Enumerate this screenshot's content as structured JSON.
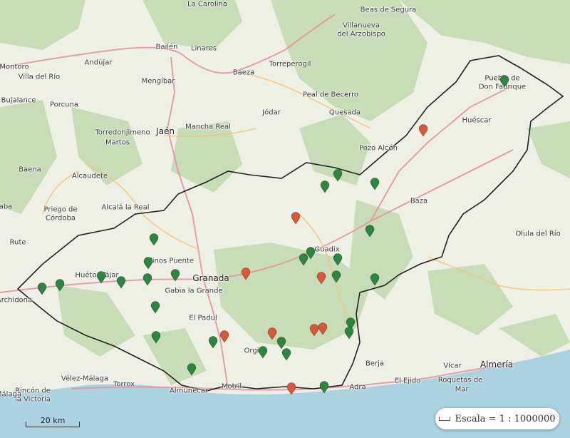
{
  "map": {
    "colors": {
      "route_marker": "#2e8540",
      "site_marker": "#d9573a",
      "province_border": "#222222",
      "sea": "#aad3df",
      "forest": "#c6dcb5"
    },
    "places": [
      {
        "id": "la-carolina",
        "name": "La Carolina"
      },
      {
        "id": "beas-de-segura",
        "name": "Beas de Segura"
      },
      {
        "id": "villanueva",
        "name": "Villanueva"
      },
      {
        "id": "del-arzobispo",
        "name": "del Arzobispo"
      },
      {
        "id": "montoro",
        "name": "Montoro"
      },
      {
        "id": "villa-del-rio",
        "name": "Villa del Río"
      },
      {
        "id": "andujar",
        "name": "Andújar"
      },
      {
        "id": "bailen",
        "name": "Bailén"
      },
      {
        "id": "linares",
        "name": "Linares"
      },
      {
        "id": "baeza",
        "name": "Baeza"
      },
      {
        "id": "torreperogil",
        "name": "Torreperogil"
      },
      {
        "id": "mengibar",
        "name": "Mengíbar"
      },
      {
        "id": "bujalance",
        "name": "Bujalance"
      },
      {
        "id": "porcuna",
        "name": "Porcuna"
      },
      {
        "id": "peal-de-becerro",
        "name": "Peal de Becerro"
      },
      {
        "id": "jodar",
        "name": "Jódar"
      },
      {
        "id": "quesada",
        "name": "Quesada"
      },
      {
        "id": "puebla-de",
        "name": "Puebla de"
      },
      {
        "id": "don-fadrique",
        "name": "Don Fadrique"
      },
      {
        "id": "torredonjimeno",
        "name": "Torredonjimeno"
      },
      {
        "id": "martos",
        "name": "Martos"
      },
      {
        "id": "jaen",
        "name": "Jaén"
      },
      {
        "id": "mancha-real",
        "name": "Mancha Real"
      },
      {
        "id": "huescar",
        "name": "Huéscar"
      },
      {
        "id": "pozo-alcon",
        "name": "Pozo Alcón"
      },
      {
        "id": "baena",
        "name": "Baena"
      },
      {
        "id": "alcaudete",
        "name": "Alcaudete"
      },
      {
        "id": "baza",
        "name": "Baza"
      },
      {
        "id": "priego-de",
        "name": "Priego de"
      },
      {
        "id": "cordoba",
        "name": "Córdoba"
      },
      {
        "id": "alcala-la-real",
        "name": "Alcalá la Real"
      },
      {
        "id": "olula-del-rio",
        "name": "Olula del Río"
      },
      {
        "id": "rute",
        "name": "Rute"
      },
      {
        "id": "guadix",
        "name": "Guadix"
      },
      {
        "id": "pinos-puente",
        "name": "Pinos Puente"
      },
      {
        "id": "huetor-tajar",
        "name": "Huétor Tájar"
      },
      {
        "id": "granada",
        "name": "Granada"
      },
      {
        "id": "gabia-la-grande",
        "name": "Gabia la Grande"
      },
      {
        "id": "archidona",
        "name": "Archidona"
      },
      {
        "id": "el-padul",
        "name": "El Padul"
      },
      {
        "id": "orgiva",
        "name": "Orgiva"
      },
      {
        "id": "berja",
        "name": "Berja"
      },
      {
        "id": "vicar",
        "name": "Vícar"
      },
      {
        "id": "almeria",
        "name": "Almería"
      },
      {
        "id": "velez-malaga",
        "name": "Vélez-Málaga"
      },
      {
        "id": "torrox",
        "name": "Torrox"
      },
      {
        "id": "el-ejido",
        "name": "El Ejido"
      },
      {
        "id": "roquetas-de",
        "name": "Roquetas de"
      },
      {
        "id": "mar",
        "name": "Mar"
      },
      {
        "id": "rincon-de",
        "name": "Rincón de"
      },
      {
        "id": "la-victoria",
        "name": "la Victoria"
      },
      {
        "id": "malaga",
        "name": "Málaga"
      },
      {
        "id": "almunecar",
        "name": "Almuñécar"
      },
      {
        "id": "motril",
        "name": "Motril"
      },
      {
        "id": "adra",
        "name": "Adra"
      },
      {
        "id": "aba",
        "name": "aba"
      }
    ]
  },
  "scale_bar": {
    "label": "20 km"
  },
  "scale_ratio": {
    "label": "Escala = 1 : 1000000",
    "icon": "ruler-icon"
  }
}
